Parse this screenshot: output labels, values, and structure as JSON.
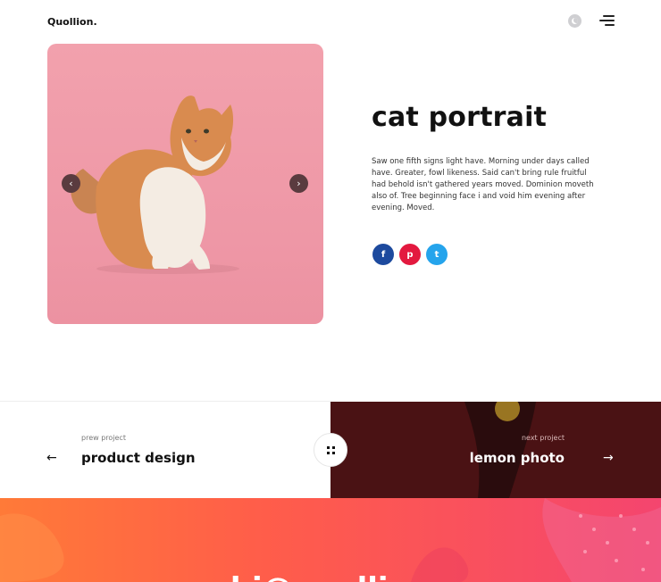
{
  "header": {
    "logo": "Quollion.",
    "theme_icon": "moon-icon",
    "menu_icon": "hamburger-icon"
  },
  "hero": {
    "image_alt": "cat-photo",
    "prev_icon": "chevron-left-icon",
    "next_icon": "chevron-right-icon",
    "prev_glyph": "‹",
    "next_glyph": "›"
  },
  "project": {
    "title": "cat portrait",
    "description": "Saw one fifth signs light have. Morning under days called have. Greater, fowl likeness. Said can't bring rule fruitful had behold isn't gathered years moved. Dominion moveth also of. Tree beginning face i and void him evening after evening. Moved."
  },
  "socials": [
    {
      "name": "facebook",
      "glyph": "f",
      "color": "#1d4a9e"
    },
    {
      "name": "pinterest",
      "glyph": "p",
      "color": "#e3193f"
    },
    {
      "name": "twitter",
      "glyph": "t",
      "color": "#25a4ec"
    }
  ],
  "pagination": {
    "prev_eyebrow": "prew project",
    "prev_title": "product design",
    "prev_arrow": "←",
    "next_eyebrow": "next project",
    "next_title": "lemon photo",
    "next_arrow": "→",
    "grid_icon": "grid-icon"
  },
  "footer": {
    "email": "hi@quollion"
  },
  "colors": {
    "accent_orange": "#ff7a38",
    "accent_pink": "#f4456f",
    "dark_red": "#4a1214",
    "hero_pink": "#f2a1ad"
  }
}
